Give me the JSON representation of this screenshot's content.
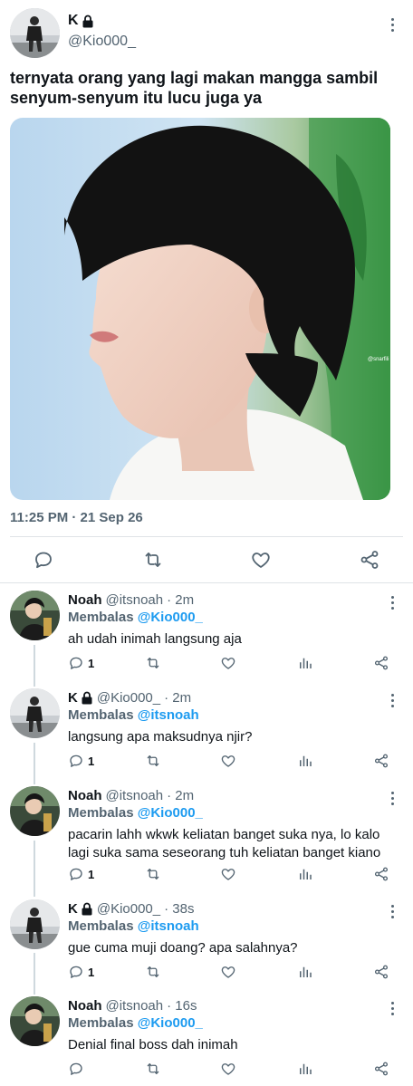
{
  "main_tweet": {
    "author_name": "K",
    "author_handle": "@Kio000_",
    "text": "ternyata orang yang lagi makan mangga sambil senyum-senyum itu lucu juga ya",
    "media_watermark": "@snarfili",
    "timestamp": "11:25 PM · 21 Sep 26"
  },
  "icons": {
    "more": "more-vertical-icon",
    "lock": "lock-icon",
    "reply": "reply-icon",
    "retweet": "retweet-icon",
    "like": "heart-icon",
    "share": "share-icon",
    "analytics": "analytics-icon"
  },
  "colors": {
    "accent": "#1d9bf0",
    "text": "#0f1419",
    "secondary": "#536471",
    "divider": "#dfe3e7"
  },
  "replies": [
    {
      "name": "Noah",
      "handle": "@itsnoah",
      "time": "· 2m",
      "replying_label": "Membalas",
      "replying_to": "@Kio000_",
      "text": "ah udah inimah langsung aja",
      "reply_count": "1",
      "locked": false
    },
    {
      "name": "K",
      "handle": "@Kio000_",
      "time": "· 2m",
      "replying_label": "Membalas",
      "replying_to": "@itsnoah",
      "text": "langsung apa maksudnya njir?",
      "reply_count": "1",
      "locked": true
    },
    {
      "name": "Noah",
      "handle": "@itsnoah",
      "time": "· 2m",
      "replying_label": "Membalas",
      "replying_to": "@Kio000_",
      "text": "pacarin lahh wkwk keliatan banget suka nya, lo kalo lagi suka sama seseorang tuh keliatan banget kiano",
      "reply_count": "1",
      "locked": false
    },
    {
      "name": "K",
      "handle": "@Kio000_",
      "time": "· 38s",
      "replying_label": "Membalas",
      "replying_to": "@itsnoah",
      "text": "gue cuma muji doang? apa salahnya?",
      "reply_count": "1",
      "locked": true
    },
    {
      "name": "Noah",
      "handle": "@itsnoah",
      "time": "· 16s",
      "replying_label": "Membalas",
      "replying_to": "@Kio000_",
      "text": "Denial final boss dah inimah",
      "reply_count": "",
      "locked": false
    }
  ]
}
